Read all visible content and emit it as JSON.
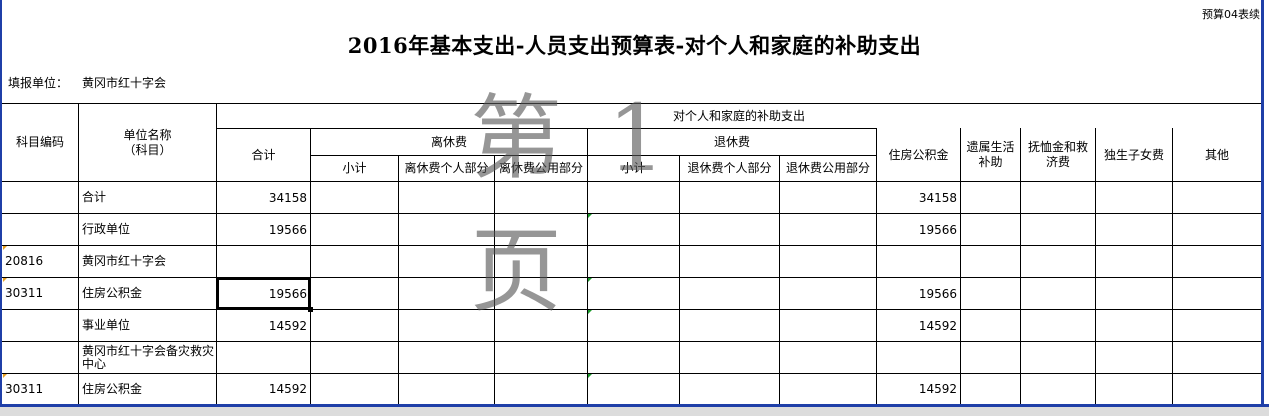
{
  "sheet": {
    "corner_note": "预算04表续",
    "title": "2016年基本支出-人员支出预算表-对个人和家庭的补助支出",
    "unit_label": "填报单位：",
    "unit_value": "黄冈市红十字会",
    "watermark": "第 1 页"
  },
  "headers": {
    "code": "科目编码",
    "name": "单位名称\n（科目）",
    "total": "合计",
    "group": "对个人和家庭的补助支出",
    "retire_leave": "离休费",
    "retire": "退休费",
    "housing": "住房公积金",
    "survivor": "遗属生活\n补助",
    "pension": "抚恤金和救\n济费",
    "onechild": "独生子女费",
    "other": "其他",
    "subtotal_a": "小计",
    "leave_personal": "离休费个人部分",
    "leave_public": "离休费公用部分",
    "subtotal_b": "小计",
    "retire_personal": "退休费个人部分",
    "retire_public": "退休费公用部分"
  },
  "rows": [
    {
      "code": "",
      "name": "合计",
      "total": "34158",
      "housing": "34158"
    },
    {
      "code": "",
      "name": "行政单位",
      "total": "19566",
      "housing": "19566"
    },
    {
      "code": "20816",
      "name": "黄冈市红十字会",
      "total": "",
      "housing": ""
    },
    {
      "code": "30311",
      "name": "住房公积金",
      "total": "19566",
      "housing": "19566"
    },
    {
      "code": "",
      "name": "事业单位",
      "total": "14592",
      "housing": "14592"
    },
    {
      "code": "",
      "name": "黄冈市红十字会备灾救灾中心",
      "total": "",
      "housing": ""
    },
    {
      "code": "30311",
      "name": "住房公积金",
      "total": "14592",
      "housing": "14592"
    }
  ],
  "colors": {
    "frame": "#1f3fa8",
    "comment_marker": "#1a9c2a",
    "error_marker": "#e8a020"
  }
}
